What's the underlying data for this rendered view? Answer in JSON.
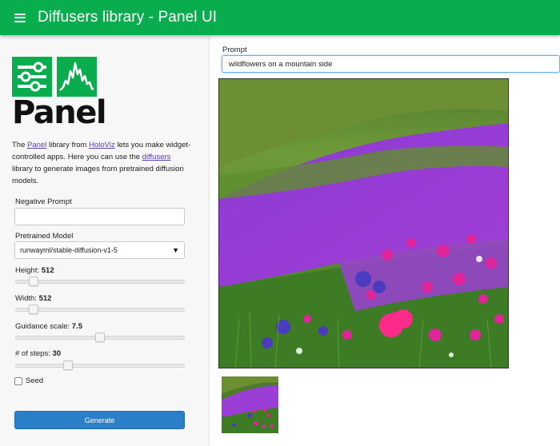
{
  "header": {
    "title": "Diffusers library - Panel UI",
    "menu_icon": "hamburger-menu-icon",
    "background_color": "#0aad4d"
  },
  "sidebar": {
    "logo": {
      "word": "Panel",
      "icons": [
        "controls-icon",
        "line-chart-icon"
      ],
      "color": "#0aad4d"
    },
    "description": {
      "t1": "The ",
      "link_panel": "Panel",
      "t2": " library from ",
      "link_holoviz": "HoloViz",
      "t3": " lets you make widget-controlled apps. Here you can use the ",
      "link_diffusers": "diffusers",
      "t4": " library to generate images from pretrained diffusion models."
    },
    "negative_prompt": {
      "label": "Negative Prompt",
      "value": ""
    },
    "model": {
      "label": "Pretrained Model",
      "value": "runwayml/stable-diffusion-v1-5"
    },
    "height": {
      "label": "Height:",
      "value": "512",
      "fraction": 0.11
    },
    "width": {
      "label": "Width:",
      "value": "512",
      "fraction": 0.11
    },
    "guidance": {
      "label": "Guidance scale:",
      "value": "7.5",
      "fraction": 0.5
    },
    "steps": {
      "label": "# of steps:",
      "value": "30",
      "fraction": 0.31
    },
    "seed": {
      "label": "Seed",
      "checked": false
    },
    "generate_label": "Generate",
    "generate_color": "#2b7fc8"
  },
  "main": {
    "prompt": {
      "label": "Prompt",
      "value": "wildflowers on a mountain side"
    }
  }
}
